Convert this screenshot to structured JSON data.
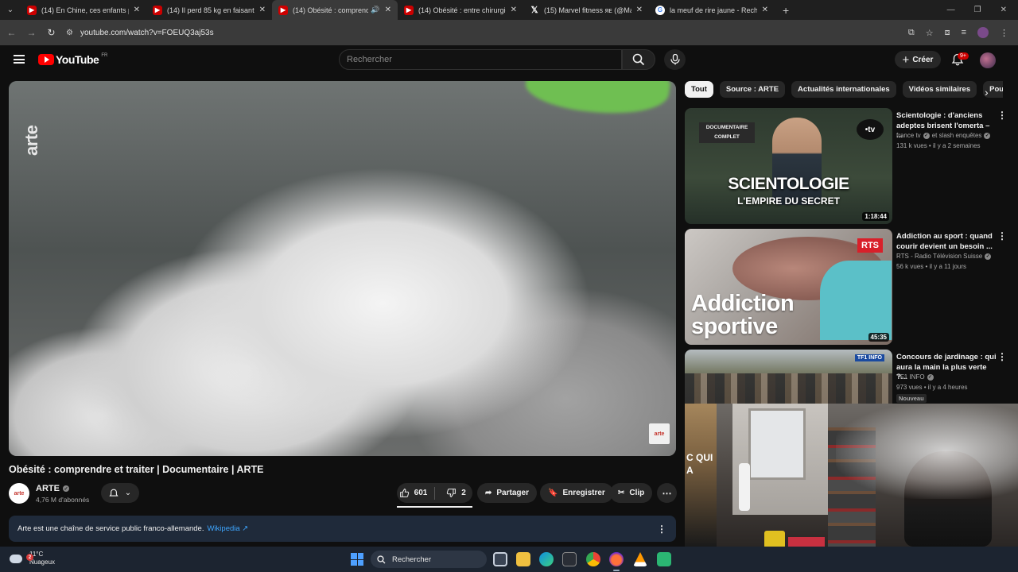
{
  "browser": {
    "tabs": [
      {
        "title": "(14) En Chine, ces enfants porte",
        "icon": "youtube-favicon",
        "active": false
      },
      {
        "title": "(14) Il perd 85 kg en faisant de",
        "icon": "youtube-favicon",
        "active": false
      },
      {
        "title": "(14) Obésité : comprendre",
        "icon": "youtube-favicon",
        "active": true,
        "playing": true
      },
      {
        "title": "(14) Obésité : entre chirurgie et",
        "icon": "youtube-favicon",
        "active": false
      },
      {
        "title": "(15) Marvel fitness ᴙᴇ (@Marvel",
        "icon": "x-favicon",
        "active": false
      },
      {
        "title": "la meuf de rire jaune - Recherc",
        "icon": "google-favicon",
        "active": false
      }
    ],
    "url": "youtube.com/watch?v=FOEUQ3aj53s"
  },
  "header": {
    "logo_text": "YouTube",
    "country": "FR",
    "search_placeholder": "Rechercher",
    "create_label": "Créer",
    "notif_count": "9+"
  },
  "video": {
    "title": "Obésité : comprendre et traiter | Documentaire | ARTE",
    "watermark": "arte",
    "corner_logo": "arte"
  },
  "channel": {
    "avatar_text": "arte",
    "name": "ARTE",
    "subscribers": "4,76 M d'abonnés"
  },
  "actions": {
    "likes": "601",
    "dislikes": "2",
    "share": "Partager",
    "save": "Enregistrer",
    "clip": "Clip"
  },
  "description": {
    "text": "Arte est une chaîne de service public franco-allemande.",
    "link": "Wikipedia ↗"
  },
  "chips": [
    "Tout",
    "Source : ARTE",
    "Actualités internationales",
    "Vidéos similaires",
    "Pou"
  ],
  "suggestions": [
    {
      "title": "Scientologie : d'anciens adeptes brisent l'omerta – ...",
      "channel": "france tv",
      "channel_extra": "et slash enquêtes",
      "meta": "131 k vues • il y a 2 semaines",
      "duration": "1:18:44",
      "thumb_badge": "DOCUMENTAIRE COMPLET",
      "thumb_text": "SCIENTOLOGIE",
      "thumb_sub": "L'EMPIRE DU SECRET",
      "thumb_logo": "•tv"
    },
    {
      "title": "Addiction au sport : quand courir devient un besoin ...",
      "channel": "RTS - Radio Télévision Suisse",
      "meta": "56 k vues • il y a 11 jours",
      "duration": "45:35",
      "thumb_logo": "RTS",
      "thumb_text": "Addiction sportive"
    },
    {
      "title": "Concours de jardinage : qui aura la main la plus verte ?...",
      "channel": "TF1 INFO",
      "meta": "973 vues • il y a 4 heures",
      "badge": "Nouveau",
      "thumb_logo": "TF1 INFO"
    }
  ],
  "partial_thumb_text": "C QUI A",
  "taskbar": {
    "weather_temp": "11°C",
    "weather_desc": "Nuageux",
    "weather_badge": "2",
    "search_label": "Rechercher"
  },
  "colors": {
    "background": "#0f0f0f",
    "youtube_red": "#ff0000",
    "link_blue": "#3ea6ff",
    "arte_red": "#c4342d"
  }
}
